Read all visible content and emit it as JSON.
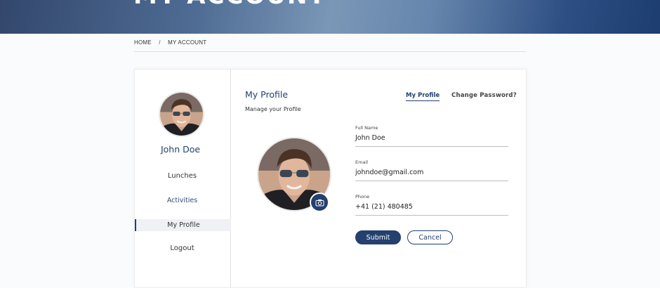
{
  "header": {
    "title": "MY ACCOUNT"
  },
  "breadcrumb": {
    "home": "HOME",
    "separator": "/",
    "current": "MY ACCOUNT"
  },
  "sidebar": {
    "user_name": "John Doe",
    "items": [
      {
        "label": "Lunches"
      },
      {
        "label": "Activities"
      },
      {
        "label": "My Profile"
      },
      {
        "label": "Logout"
      }
    ]
  },
  "main": {
    "title": "My Profile",
    "subtitle": "Manage your Profile",
    "tabs": [
      {
        "label": "My Profile",
        "active": true
      },
      {
        "label": "Change Password?",
        "active": false
      }
    ],
    "form": {
      "full_name": {
        "label": "Full Name",
        "value": "John Doe"
      },
      "email": {
        "label": "Email",
        "value": "johndoe@gmail.com"
      },
      "phone": {
        "label": "Phone",
        "value": "+41 (21) 480485"
      }
    },
    "buttons": {
      "submit": "Submit",
      "cancel": "Cancel"
    },
    "icons": {
      "avatar_upload": "camera-icon"
    }
  },
  "colors": {
    "accent": "#24406e",
    "hero_start": "#33476c",
    "hero_end": "#1d3d70"
  }
}
